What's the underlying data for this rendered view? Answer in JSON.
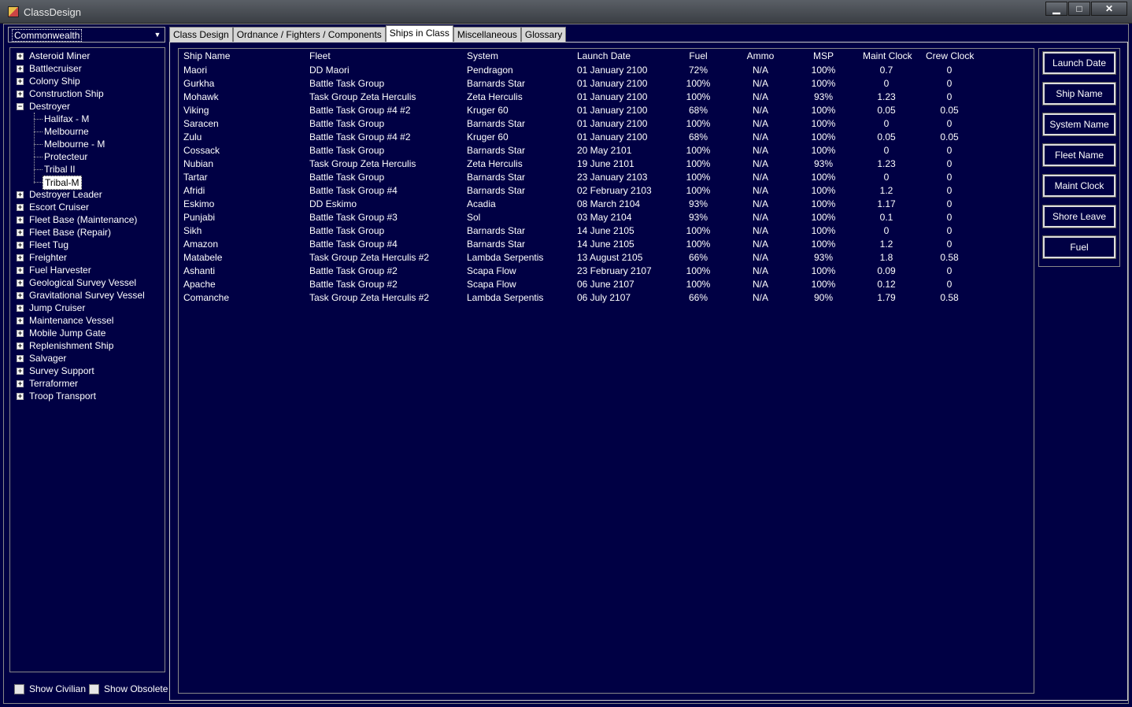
{
  "window": {
    "title": "ClassDesign",
    "minimize": "▁",
    "maximize": "□",
    "close": "✕"
  },
  "race_select": {
    "value": "Commonwealth",
    "icon": "chevron-down-icon"
  },
  "tree": {
    "items": [
      {
        "label": "Asteroid Miner",
        "expanded": false
      },
      {
        "label": "Battlecruiser",
        "expanded": false
      },
      {
        "label": "Colony Ship",
        "expanded": false
      },
      {
        "label": "Construction Ship",
        "expanded": false
      },
      {
        "label": "Destroyer",
        "expanded": true
      },
      {
        "label": "Destroyer Leader",
        "expanded": false
      },
      {
        "label": "Escort Cruiser",
        "expanded": false
      },
      {
        "label": "Fleet Base (Maintenance)",
        "expanded": false
      },
      {
        "label": "Fleet Base (Repair)",
        "expanded": false
      },
      {
        "label": "Fleet Tug",
        "expanded": false
      },
      {
        "label": "Freighter",
        "expanded": false
      },
      {
        "label": "Fuel Harvester",
        "expanded": false
      },
      {
        "label": "Geological Survey Vessel",
        "expanded": false
      },
      {
        "label": "Gravitational Survey Vessel",
        "expanded": false
      },
      {
        "label": "Jump Cruiser",
        "expanded": false
      },
      {
        "label": "Maintenance Vessel",
        "expanded": false
      },
      {
        "label": "Mobile Jump Gate",
        "expanded": false
      },
      {
        "label": "Replenishment Ship",
        "expanded": false
      },
      {
        "label": "Salvager",
        "expanded": false
      },
      {
        "label": "Survey Support",
        "expanded": false
      },
      {
        "label": "Terraformer",
        "expanded": false
      },
      {
        "label": "Troop Transport",
        "expanded": false
      }
    ],
    "destroyer_children": [
      "Halifax - M",
      "Melbourne",
      "Melbourne - M",
      "Protecteur",
      "Tribal II",
      "Tribal-M"
    ],
    "selected": "Tribal-M"
  },
  "checkboxes": {
    "show_civilian": "Show Civilian",
    "show_obsolete": "Show Obsolete"
  },
  "tabs": [
    "Class Design",
    "Ordnance / Fighters / Components",
    "Ships in Class",
    "Miscellaneous",
    "Glossary"
  ],
  "active_tab": "Ships in Class",
  "grid": {
    "headers": [
      "Ship Name",
      "Fleet",
      "System",
      "Launch Date",
      "Fuel",
      "Ammo",
      "MSP",
      "Maint Clock",
      "Crew Clock"
    ],
    "rows": [
      [
        "Maori",
        "DD Maori",
        "Pendragon",
        "01 January 2100",
        "72%",
        "N/A",
        "100%",
        "0.7",
        "0"
      ],
      [
        "Gurkha",
        "Battle Task Group",
        "Barnards Star",
        "01 January 2100",
        "100%",
        "N/A",
        "100%",
        "0",
        "0"
      ],
      [
        "Mohawk",
        "Task Group Zeta Herculis",
        "Zeta Herculis",
        "01 January 2100",
        "100%",
        "N/A",
        "93%",
        "1.23",
        "0"
      ],
      [
        "Viking",
        "Battle Task Group #4 #2",
        "Kruger 60",
        "01 January 2100",
        "68%",
        "N/A",
        "100%",
        "0.05",
        "0.05"
      ],
      [
        "Saracen",
        "Battle Task Group",
        "Barnards Star",
        "01 January 2100",
        "100%",
        "N/A",
        "100%",
        "0",
        "0"
      ],
      [
        "Zulu",
        "Battle Task Group #4 #2",
        "Kruger 60",
        "01 January 2100",
        "68%",
        "N/A",
        "100%",
        "0.05",
        "0.05"
      ],
      [
        "Cossack",
        "Battle Task Group",
        "Barnards Star",
        "20 May 2101",
        "100%",
        "N/A",
        "100%",
        "0",
        "0"
      ],
      [
        "Nubian",
        "Task Group Zeta Herculis",
        "Zeta Herculis",
        "19 June 2101",
        "100%",
        "N/A",
        "93%",
        "1.23",
        "0"
      ],
      [
        "Tartar",
        "Battle Task Group",
        "Barnards Star",
        "23 January 2103",
        "100%",
        "N/A",
        "100%",
        "0",
        "0"
      ],
      [
        "Afridi",
        "Battle Task Group #4",
        "Barnards Star",
        "02 February 2103",
        "100%",
        "N/A",
        "100%",
        "1.2",
        "0"
      ],
      [
        "Eskimo",
        "DD Eskimo",
        "Acadia",
        "08 March 2104",
        "93%",
        "N/A",
        "100%",
        "1.17",
        "0"
      ],
      [
        "Punjabi",
        "Battle Task Group #3",
        "Sol",
        "03 May 2104",
        "93%",
        "N/A",
        "100%",
        "0.1",
        "0"
      ],
      [
        "Sikh",
        "Battle Task Group",
        "Barnards Star",
        "14 June 2105",
        "100%",
        "N/A",
        "100%",
        "0",
        "0"
      ],
      [
        "Amazon",
        "Battle Task Group #4",
        "Barnards Star",
        "14 June 2105",
        "100%",
        "N/A",
        "100%",
        "1.2",
        "0"
      ],
      [
        "Matabele",
        "Task Group Zeta Herculis #2",
        "Lambda Serpentis",
        "13 August 2105",
        "66%",
        "N/A",
        "93%",
        "1.8",
        "0.58"
      ],
      [
        "Ashanti",
        "Battle Task Group #2",
        "Scapa Flow",
        "23 February 2107",
        "100%",
        "N/A",
        "100%",
        "0.09",
        "0"
      ],
      [
        "Apache",
        "Battle Task Group #2",
        "Scapa Flow",
        "06 June 2107",
        "100%",
        "N/A",
        "100%",
        "0.12",
        "0"
      ],
      [
        "Comanche",
        "Task Group Zeta Herculis #2",
        "Lambda Serpentis",
        "06 July 2107",
        "66%",
        "N/A",
        "90%",
        "1.79",
        "0.58"
      ]
    ]
  },
  "sort_buttons": [
    "Launch Date",
    "Ship Name",
    "System Name",
    "Fleet Name",
    "Maint Clock",
    "Shore Leave",
    "Fuel"
  ]
}
